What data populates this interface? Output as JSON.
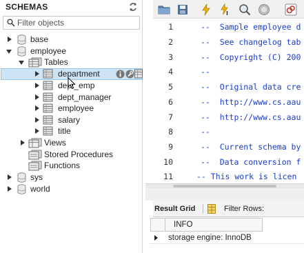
{
  "schemas_panel": {
    "title": "SCHEMAS",
    "filter_placeholder": "Filter objects",
    "tree": {
      "base": "base",
      "employee": "employee",
      "tables": "Tables",
      "department": "department",
      "dept_emp": "dept_emp",
      "dept_manager": "dept_manager",
      "employee_table": "employee",
      "salary": "salary",
      "title": "title",
      "views": "Views",
      "stored_procedures": "Stored Procedures",
      "functions": "Functions",
      "sys": "sys",
      "world": "world"
    }
  },
  "editor": {
    "lines": [
      {
        "num": "1",
        "text": "--  Sample employee d"
      },
      {
        "num": "2",
        "text": "--  See changelog tab"
      },
      {
        "num": "3",
        "text": "--  Copyright (C) 200"
      },
      {
        "num": "4",
        "text": "--"
      },
      {
        "num": "5",
        "text": "--  Original data cre"
      },
      {
        "num": "6",
        "text": "--  http://www.cs.aau"
      },
      {
        "num": "7",
        "text": "--  http://www.cs.aau"
      },
      {
        "num": "8",
        "text": "--"
      },
      {
        "num": "9",
        "text": "--  Current schema by"
      },
      {
        "num": "10",
        "text": "--  Data conversion f"
      },
      {
        "num": "11",
        "text": "-- This work is licen"
      }
    ]
  },
  "results": {
    "tab_result_grid": "Result Grid",
    "filter_rows": "Filter Rows:",
    "column_header": "INFO",
    "row_value": "storage engine: InnoDB"
  },
  "colors": {
    "selection": "#cde4f7",
    "code_comment": "#1a3ccc"
  }
}
